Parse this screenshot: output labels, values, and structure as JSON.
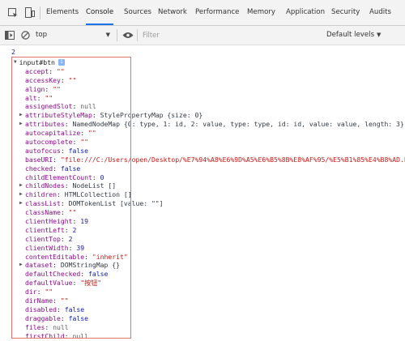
{
  "tabs": [
    {
      "label": "Elements",
      "active": false
    },
    {
      "label": "Console",
      "active": true
    },
    {
      "label": "Sources",
      "active": false
    },
    {
      "label": "Network",
      "active": false
    },
    {
      "label": "Performance",
      "active": false
    },
    {
      "label": "Memory",
      "active": false
    },
    {
      "label": "Application",
      "active": false
    },
    {
      "label": "Security",
      "active": false
    },
    {
      "label": "Audits",
      "active": false
    }
  ],
  "icons": {
    "inspect": "element-picker-icon",
    "device": "device-toolbar-icon",
    "sidebar": "sidebar-toggle-icon",
    "clear": "clear-console-icon",
    "eye": "eye-icon"
  },
  "toolbar": {
    "context": "top",
    "filter_placeholder": "Filter",
    "levels": "Default levels"
  },
  "console": {
    "result": "2",
    "object_header": "input#btn",
    "properties": [
      {
        "key": "accept",
        "value": "\"\"",
        "type": "string",
        "expandable": false
      },
      {
        "key": "accessKey",
        "value": "\"\"",
        "type": "string",
        "expandable": false
      },
      {
        "key": "align",
        "value": "\"\"",
        "type": "string",
        "expandable": false
      },
      {
        "key": "alt",
        "value": "\"\"",
        "type": "string",
        "expandable": false
      },
      {
        "key": "assignedSlot",
        "value": "null",
        "type": "null",
        "expandable": false
      },
      {
        "key": "attributeStyleMap",
        "value": "StylePropertyMap {size: 0}",
        "type": "object",
        "expandable": true
      },
      {
        "key": "attributes",
        "value": "NamedNodeMap {0: type, 1: id, 2: value, type: type, id: id, value: value, length: 3}",
        "type": "object",
        "expandable": true
      },
      {
        "key": "autocapitalize",
        "value": "\"\"",
        "type": "string",
        "expandable": false
      },
      {
        "key": "autocomplete",
        "value": "\"\"",
        "type": "string",
        "expandable": false
      },
      {
        "key": "autofocus",
        "value": "false",
        "type": "bool",
        "expandable": false
      },
      {
        "key": "baseURI",
        "value": "\"file:///C:/Users/open/Desktop/%E7%94%A8%E6%9D%A5%E6%B5%8B%E8%AF%95/%E5%B1%85%E4%B8%AD.html\"",
        "type": "string",
        "expandable": false
      },
      {
        "key": "checked",
        "value": "false",
        "type": "bool",
        "expandable": false
      },
      {
        "key": "childElementCount",
        "value": "0",
        "type": "number",
        "expandable": false
      },
      {
        "key": "childNodes",
        "value": "NodeList []",
        "type": "object",
        "expandable": true
      },
      {
        "key": "children",
        "value": "HTMLCollection []",
        "type": "object",
        "expandable": true
      },
      {
        "key": "classList",
        "value": "DOMTokenList [value: \"\"]",
        "type": "object",
        "expandable": true
      },
      {
        "key": "className",
        "value": "\"\"",
        "type": "string",
        "expandable": false
      },
      {
        "key": "clientHeight",
        "value": "19",
        "type": "number",
        "expandable": false
      },
      {
        "key": "clientLeft",
        "value": "2",
        "type": "number",
        "expandable": false
      },
      {
        "key": "clientTop",
        "value": "2",
        "type": "number",
        "expandable": false
      },
      {
        "key": "clientWidth",
        "value": "39",
        "type": "number",
        "expandable": false
      },
      {
        "key": "contentEditable",
        "value": "\"inherit\"",
        "type": "string",
        "expandable": false
      },
      {
        "key": "dataset",
        "value": "DOMStringMap {}",
        "type": "object",
        "expandable": true
      },
      {
        "key": "defaultChecked",
        "value": "false",
        "type": "bool",
        "expandable": false
      },
      {
        "key": "defaultValue",
        "value": "\"按钮\"",
        "type": "string",
        "expandable": false
      },
      {
        "key": "dir",
        "value": "\"\"",
        "type": "string",
        "expandable": false
      },
      {
        "key": "dirName",
        "value": "\"\"",
        "type": "string",
        "expandable": false
      },
      {
        "key": "disabled",
        "value": "false",
        "type": "bool",
        "expandable": false
      },
      {
        "key": "draggable",
        "value": "false",
        "type": "bool",
        "expandable": false
      },
      {
        "key": "files",
        "value": "null",
        "type": "null",
        "expandable": false
      },
      {
        "key": "firstChild",
        "value": "null",
        "type": "null",
        "expandable": false
      }
    ]
  },
  "colors": {
    "highlight_border": "#e57373",
    "active_tab_underline": "#1a73e8",
    "key": "#8b0a8b",
    "string": "#c41a16",
    "number": "#1a1aa6"
  }
}
